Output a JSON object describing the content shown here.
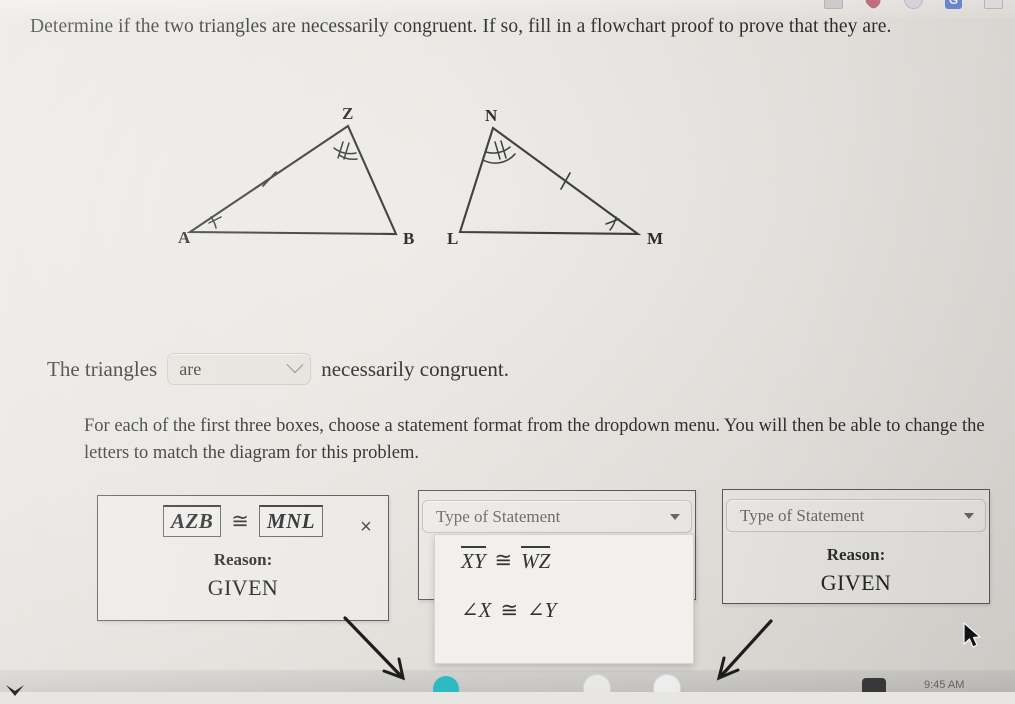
{
  "browser": {
    "tab_icons": [
      "document-icon",
      "heart-icon",
      "circle-icon",
      "google-classroom-icon",
      "page-icon"
    ]
  },
  "prompt": {
    "text": "Determine if the two triangles are necessarily congruent. If so, fill in a flowchart proof to prove that they are."
  },
  "figure": {
    "triangle_left": {
      "vertices": [
        "A",
        "Z",
        "B"
      ],
      "marks": {
        "side_az_ticks": 1,
        "angle_a_arcs": 1,
        "angle_z_arcs": 2
      }
    },
    "triangle_right": {
      "vertices": [
        "N",
        "L",
        "M"
      ],
      "marks": {
        "side_nm_ticks": 1,
        "angle_n_arcs": 2,
        "angle_m_arcs": 1
      }
    }
  },
  "sentence": {
    "prefix": "The triangles",
    "select_value": "are",
    "suffix": "necessarily congruent."
  },
  "instructions": {
    "text": "For each of the first three boxes, choose a statement format from the dropdown menu. You will then be able to change the letters to match the diagram for this problem."
  },
  "proof": {
    "box1": {
      "left_value": "AZB",
      "congruence_symbol": "≅",
      "right_value": "MNL",
      "close_label": "×",
      "reason_label": "Reason:",
      "reason_value": "GIVEN"
    },
    "box2": {
      "select_placeholder": "Type of Statement",
      "menu_options": [
        "XY ≅ WZ",
        "∠X ≅ ∠Y",
        ""
      ],
      "menu_option_parts": [
        {
          "left": "XY",
          "symbol": "≅",
          "right": "WZ",
          "overline": true
        },
        {
          "left": "∠X",
          "symbol": "≅",
          "right": "∠Y",
          "overline": false
        }
      ],
      "scroll_hint": "⌄"
    },
    "box3": {
      "select_placeholder": "Type of Statement",
      "reason_label": "Reason:",
      "reason_value": "GIVEN"
    }
  },
  "dock": {
    "clock": "9:45 AM"
  },
  "colors": {
    "page_background": "#e8e6e2",
    "box_border": "#5c5c5e",
    "text": "#2e2e30",
    "placeholder_text": "#6f6d6a",
    "accent_blue": "#4168d6"
  }
}
